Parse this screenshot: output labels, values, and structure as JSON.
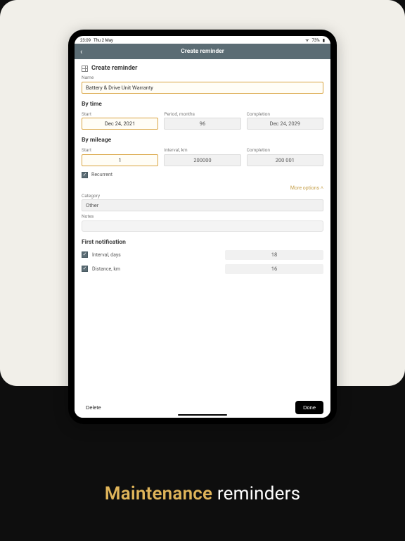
{
  "status": {
    "time": "23:09",
    "date": "Thu 2 May",
    "battery": "73%"
  },
  "navbar": {
    "title": "Create reminder"
  },
  "page": {
    "heading": "Create reminder",
    "name_label": "Name",
    "name_value": "Battery & Drive Unit Warranty"
  },
  "by_time": {
    "title": "By time",
    "start_label": "Start",
    "start_value": "Dec 24, 2021",
    "period_label": "Period, months",
    "period_value": "96",
    "completion_label": "Completion",
    "completion_value": "Dec 24, 2029"
  },
  "by_mileage": {
    "title": "By mileage",
    "start_label": "Start",
    "start_value": "1",
    "interval_label": "Interval, km",
    "interval_value": "200000",
    "completion_label": "Completion",
    "completion_value": "200 001"
  },
  "recurrent_label": "Recurrent",
  "more_options_label": "More options",
  "category": {
    "label": "Category",
    "value": "Other"
  },
  "notes_label": "Notes",
  "first_notif": {
    "title": "First notification",
    "interval_label": "Interval, days",
    "interval_value": "18",
    "distance_label": "Distance, km",
    "distance_value": "16"
  },
  "buttons": {
    "delete": "Delete",
    "done": "Done"
  },
  "caption": {
    "word1": "Maintenance",
    "word2": "reminders"
  }
}
